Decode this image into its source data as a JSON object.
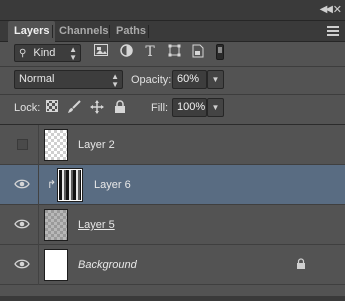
{
  "tabs": [
    {
      "label": "Layers",
      "active": true
    },
    {
      "label": "Channels",
      "active": false
    },
    {
      "label": "Paths",
      "active": false
    }
  ],
  "filter": {
    "kind_label": "Kind",
    "icons": [
      "pixel-filter-icon",
      "adjustment-filter-icon",
      "type-filter-icon",
      "shape-filter-icon",
      "smart-object-filter-icon",
      "filter-toggle-icon"
    ]
  },
  "blend": {
    "mode": "Normal",
    "opacity_label": "Opacity:",
    "opacity_value": "60%"
  },
  "lock": {
    "label": "Lock:",
    "icons": [
      "lock-transparent-icon",
      "lock-image-icon",
      "lock-position-icon",
      "lock-all-icon"
    ],
    "fill_label": "Fill:",
    "fill_value": "100%"
  },
  "layers": [
    {
      "name": "Layer 2",
      "visible": false,
      "selected": false,
      "thumb": "transparent-checker"
    },
    {
      "name": "Layer 6",
      "visible": true,
      "selected": true,
      "clipped": true,
      "thumb": "stripes"
    },
    {
      "name": "Layer 5",
      "visible": true,
      "selected": false,
      "thumb": "grey-checker"
    },
    {
      "name": "Background",
      "visible": true,
      "selected": false,
      "locked": true,
      "thumb": "white"
    }
  ],
  "colors": {
    "panel_bg": "#535353",
    "selected_row": "#596c82"
  }
}
